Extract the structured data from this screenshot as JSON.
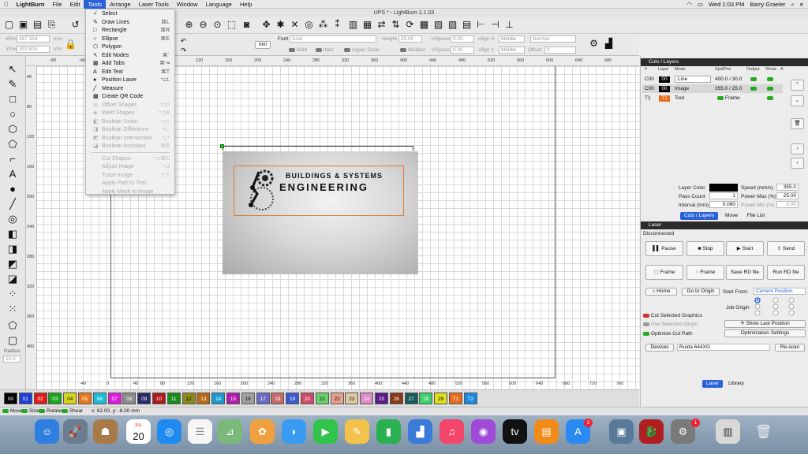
{
  "menubar": {
    "app": "LightBurn",
    "items": [
      "File",
      "Edit",
      "Tools",
      "Arrange",
      "Laser Tools",
      "Window",
      "Language",
      "Help"
    ],
    "active": "Tools",
    "clock": "Wed 1:03 PM",
    "user": "Barry Graeler"
  },
  "window_title": "UPS * - LightBurn 1.1.03",
  "toolbar": {
    "xpos_label": "XPos",
    "xpos_value": "287.324",
    "ypos_label": "YPos",
    "ypos_value": "202.815",
    "unit_mm": "mm",
    "font_label": "Font",
    "font_value": "Arial",
    "height_label": "Height",
    "height_value": "25.00",
    "hspace_label": "HSpace",
    "hspace_value": "0.00",
    "vspace_label": "VSpace",
    "vspace_value": "0.00",
    "alignx_label": "Align X",
    "alignx_value": "Middle",
    "aligny_label": "Align Y",
    "aligny_value": "Middle",
    "normal": "Normal",
    "offset_label": "Offset",
    "offset_value": "0",
    "bold": "Bold",
    "italic": "Italic",
    "upper": "Upper Case",
    "welded": "Welded",
    "mm_btn": "mm"
  },
  "tools_menu": [
    {
      "label": "Select",
      "shortcut": "",
      "icon": "✓",
      "enabled": true
    },
    {
      "label": "Draw Lines",
      "shortcut": "⌘L",
      "icon": "✎",
      "enabled": true
    },
    {
      "label": "Rectangle",
      "shortcut": "⌘R",
      "icon": "□",
      "enabled": true
    },
    {
      "label": "Ellipse",
      "shortcut": "⌘E",
      "icon": "○",
      "enabled": true
    },
    {
      "label": "Polygon",
      "shortcut": "",
      "icon": "⬡",
      "enabled": true
    },
    {
      "label": "Edit Nodes",
      "shortcut": "⌘`",
      "icon": "↖",
      "enabled": true
    },
    {
      "label": "Add Tabs",
      "shortcut": "⌘⇥",
      "icon": "▦",
      "enabled": true
    },
    {
      "label": "Edit Text",
      "shortcut": "⌘T",
      "icon": "A",
      "enabled": true
    },
    {
      "label": "Position Laser",
      "shortcut": "⌥L",
      "icon": "●",
      "enabled": true
    },
    {
      "label": "Measure",
      "shortcut": "",
      "icon": "╱",
      "enabled": true
    },
    {
      "label": "Create QR Code",
      "shortcut": "",
      "icon": "▩",
      "enabled": true
    },
    {
      "label": "Offset Shapes",
      "shortcut": "⌥O",
      "icon": "◎",
      "enabled": false
    },
    {
      "label": "Weld Shapes",
      "shortcut": "⌥W",
      "icon": "◈",
      "enabled": false
    },
    {
      "label": "Boolean Union",
      "shortcut": "⌥+",
      "icon": "◧",
      "enabled": false
    },
    {
      "label": "Boolean Difference",
      "shortcut": "⌥-",
      "icon": "◨",
      "enabled": false
    },
    {
      "label": "Boolean Intersection",
      "shortcut": "⌥*",
      "icon": "◩",
      "enabled": false
    },
    {
      "label": "Boolean Assistant",
      "shortcut": "⌘B",
      "icon": "◪",
      "enabled": false
    },
    {
      "label": "Cut Shapes",
      "shortcut": "⌥⌘C",
      "icon": "",
      "enabled": false
    },
    {
      "label": "Adjust Image",
      "shortcut": "⌥I",
      "icon": "",
      "enabled": false
    },
    {
      "label": "Trace Image",
      "shortcut": "⌥T",
      "icon": "",
      "enabled": false
    },
    {
      "label": "Apply Path to Text",
      "shortcut": "",
      "icon": "",
      "enabled": false
    },
    {
      "label": "Apply Mask to Image",
      "shortcut": "",
      "icon": "",
      "enabled": false
    }
  ],
  "ruler_top": [
    "-80",
    "-40",
    "0",
    "40",
    "80",
    "120",
    "160",
    "200",
    "240",
    "280",
    "320",
    "360",
    "400",
    "440",
    "480",
    "520",
    "560",
    "600",
    "640",
    "680"
  ],
  "ruler_left": [
    "40",
    "80",
    "120",
    "160",
    "200",
    "240",
    "280",
    "320",
    "360",
    "400"
  ],
  "ruler_bottom": [
    "-40",
    "0",
    "40",
    "80",
    "120",
    "160",
    "200",
    "240",
    "280",
    "320",
    "360",
    "400",
    "440",
    "480",
    "520",
    "560",
    "600",
    "640",
    "680",
    "720",
    "760"
  ],
  "artwork": {
    "title": "BUILDINGS & SYSTEMS",
    "subtitle": "ENGINEERING"
  },
  "palette": [
    {
      "label": "00",
      "color": "#000000"
    },
    {
      "label": "01",
      "color": "#1f3fd6"
    },
    {
      "label": "02",
      "color": "#e01b1b"
    },
    {
      "label": "03",
      "color": "#1aa51a"
    },
    {
      "label": "04",
      "color": "#d6d61a"
    },
    {
      "label": "05",
      "color": "#e87a1a"
    },
    {
      "label": "06",
      "color": "#1abfd6"
    },
    {
      "label": "07",
      "color": "#e01ae0"
    },
    {
      "label": "08",
      "color": "#8c8c8c"
    },
    {
      "label": "09",
      "color": "#2a2a6a"
    },
    {
      "label": "10",
      "color": "#aa1a1a"
    },
    {
      "label": "11",
      "color": "#1a8a1a"
    },
    {
      "label": "12",
      "color": "#8a8a1a"
    },
    {
      "label": "13",
      "color": "#b86a1a"
    },
    {
      "label": "14",
      "color": "#1a9ad0"
    },
    {
      "label": "15",
      "color": "#b01ab0"
    },
    {
      "label": "16",
      "color": "#a0a0a0"
    },
    {
      "label": "17",
      "color": "#6a6ac8"
    },
    {
      "label": "18",
      "color": "#c86a6a"
    },
    {
      "label": "19",
      "color": "#3a5ad0"
    },
    {
      "label": "20",
      "color": "#d04a6a"
    },
    {
      "label": "21",
      "color": "#6ad06a"
    },
    {
      "label": "22",
      "color": "#e8a08a"
    },
    {
      "label": "23",
      "color": "#e0c8a0"
    },
    {
      "label": "24",
      "color": "#e08ac8"
    },
    {
      "label": "25",
      "color": "#5a1a8a"
    },
    {
      "label": "26",
      "color": "#8a3a1a"
    },
    {
      "label": "27",
      "color": "#1a5a5a"
    },
    {
      "label": "28",
      "color": "#3ad06a"
    },
    {
      "label": "29",
      "color": "#e0e01a"
    },
    {
      "label": "T1",
      "color": "#e86a1a"
    },
    {
      "label": "T2",
      "color": "#1a8ae0"
    }
  ],
  "status": {
    "move": "Move",
    "size": "Size",
    "rotate": "Rotate",
    "shear": "Shear",
    "coords": "x: 62.00, y: -8.00 mm"
  },
  "cuts_panel": {
    "title": "Cuts / Layers",
    "headers": [
      "#",
      "Layer",
      "Mode",
      "Spd/Pwr",
      "Output",
      "Show",
      "A"
    ],
    "rows": [
      {
        "num": "C00",
        "layer": "00",
        "mode": "Line",
        "spdpwr": "400.0 / 30.0",
        "color": "#000000"
      },
      {
        "num": "C00",
        "layer": "00",
        "mode": "Image",
        "spdpwr": "355.0 / 25.0",
        "color": "#000000"
      },
      {
        "num": "T1",
        "layer": "T1",
        "mode": "Tool",
        "spdpwr": "Frame",
        "color": "#e86a1a"
      }
    ],
    "layer_color_label": "Layer Color",
    "speed_label": "Speed (mm/s)",
    "speed_value": "355.0",
    "pass_label": "Pass Count",
    "pass_value": "1",
    "powermax_label": "Power Max (%)",
    "powermax_value": "25.00",
    "interval_label": "Interval (mm)",
    "interval_value": "0.080",
    "powermin_label": "Power Min (%)",
    "powermin_value": "0.00",
    "tabs": [
      "Cuts / Layers",
      "Move",
      "File List"
    ]
  },
  "laser_panel": {
    "title": "Laser",
    "state": "Disconnected",
    "pause": "Pause",
    "stop": "Stop",
    "start": "Start",
    "send": "Send",
    "frame1": "Frame",
    "frame2": "Frame",
    "save_rd": "Save RD file",
    "run_rd": "Run RD file",
    "home": "Home",
    "go_origin": "Go to Origin",
    "start_from_label": "Start From:",
    "start_from_value": "Current Position",
    "job_origin": "Job Origin",
    "cut_selected": "Cut Selected Graphics",
    "use_selection": "Use Selection Origin",
    "show_last": "Show Last Position",
    "optimize": "Optimize Cut Path",
    "opt_settings": "Optimization Settings",
    "devices": "Devices",
    "device_value": "Ruida 644XG",
    "rescan": "Re-scan",
    "tabs": [
      "Laser",
      "Library"
    ]
  },
  "dock_badges": {
    "appstore": "3",
    "prefs": "1"
  },
  "calendar": {
    "month": "JUL",
    "day": "20"
  }
}
